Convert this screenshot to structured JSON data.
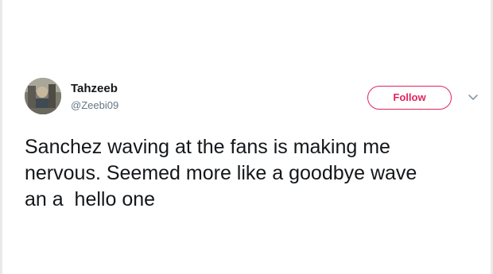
{
  "tweet": {
    "user_name": "Tahzeeb",
    "user_handle": "@Zeebi09",
    "follow_label": "Follow",
    "text": "Sanchez waving at the fans is making me\nnervous. Seemed more like a goodbye wave\nan a  hello one"
  },
  "icons": {
    "more": "chevron-down-icon",
    "avatar": "profile-photo"
  },
  "colors": {
    "follow_accent": "#e0245e",
    "handle": "#657786",
    "text": "#14171a"
  }
}
